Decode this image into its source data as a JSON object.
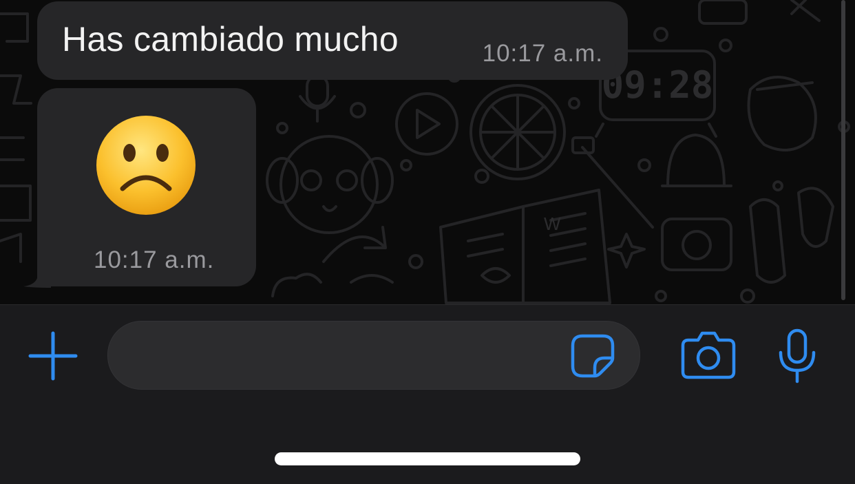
{
  "messages": [
    {
      "type": "text",
      "text": "Has cambiado mucho",
      "time": "10:17 a.m."
    },
    {
      "type": "emoji",
      "emoji_name": "frowning-face-emoji",
      "time": "10:17 a.m."
    }
  ],
  "composer": {
    "input_value": "",
    "icons": {
      "attach": "plus-icon",
      "sticker": "sticker-icon",
      "camera": "camera-icon",
      "mic": "microphone-icon"
    },
    "accent_color": "#2f8cf0"
  },
  "wallpaper": {
    "clock_text": "09:28",
    "book_letter": "W"
  },
  "colors": {
    "bubble": "#262628",
    "chat_background": "#0b0b0b",
    "composer_background": "#1b1b1d"
  }
}
